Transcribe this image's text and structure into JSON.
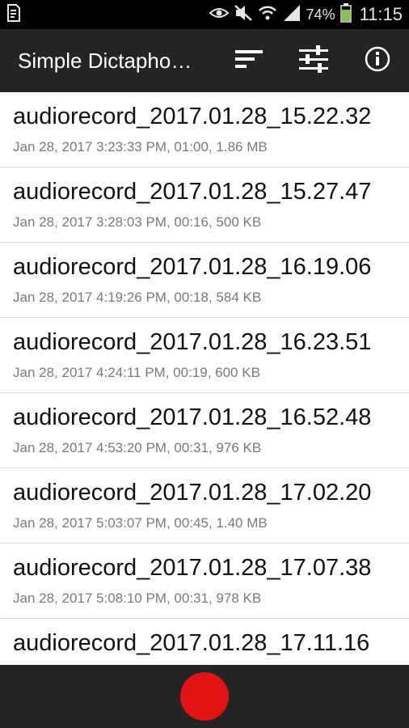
{
  "status_bar": {
    "battery_percent": "74%",
    "time": "11:15",
    "icons": [
      "document-icon",
      "eye-icon",
      "mute-icon",
      "wifi-icon",
      "signal-icon",
      "battery-icon"
    ]
  },
  "app_bar": {
    "title": "Simple Dictapho…",
    "actions": [
      "sort-icon",
      "settings-sliders-icon",
      "info-icon"
    ]
  },
  "recordings": [
    {
      "name": "audiorecord_2017.01.28_15.22.32",
      "meta": "Jan 28, 2017 3:23:33 PM, 01:00, 1.86 MB"
    },
    {
      "name": "audiorecord_2017.01.28_15.27.47",
      "meta": "Jan 28, 2017 3:28:03 PM, 00:16, 500 KB"
    },
    {
      "name": "audiorecord_2017.01.28_16.19.06",
      "meta": "Jan 28, 2017 4:19:26 PM, 00:18, 584 KB"
    },
    {
      "name": "audiorecord_2017.01.28_16.23.51",
      "meta": "Jan 28, 2017 4:24:11 PM, 00:19, 600 KB"
    },
    {
      "name": "audiorecord_2017.01.28_16.52.48",
      "meta": "Jan 28, 2017 4:53:20 PM, 00:31, 976 KB"
    },
    {
      "name": "audiorecord_2017.01.28_17.02.20",
      "meta": "Jan 28, 2017 5:03:07 PM, 00:45, 1.40 MB"
    },
    {
      "name": "audiorecord_2017.01.28_17.07.38",
      "meta": "Jan 28, 2017 5:08:10 PM, 00:31, 978 KB"
    },
    {
      "name": "audiorecord_2017.01.28_17.11.16",
      "meta": ""
    }
  ],
  "colors": {
    "app_bar": "#242424",
    "record_button": "#e01414",
    "list_background": "#ffffff",
    "battery_fill": "#8bc34a"
  }
}
